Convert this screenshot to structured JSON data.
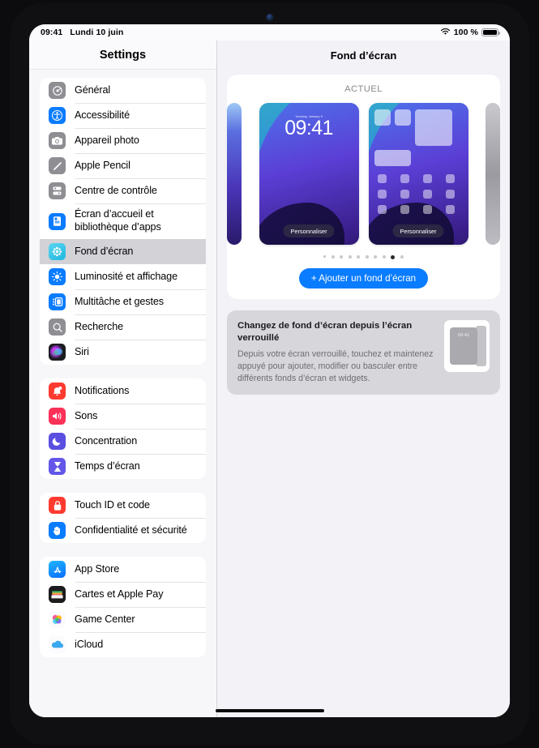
{
  "status_bar": {
    "time": "09:41",
    "date": "Lundi 10 juin",
    "wifi_icon": "wifi-icon",
    "battery_percent": "100 %",
    "battery_icon": "battery-full-icon"
  },
  "sidebar": {
    "title": "Settings",
    "groups": [
      {
        "items": [
          {
            "label": "Général",
            "icon": "gear-icon",
            "selected": false
          },
          {
            "label": "Accessibilité",
            "icon": "accessibility-icon",
            "selected": false
          },
          {
            "label": "Appareil photo",
            "icon": "camera-icon",
            "selected": false
          },
          {
            "label": "Apple Pencil",
            "icon": "pencil-icon",
            "selected": false
          },
          {
            "label": "Centre de contrôle",
            "icon": "control-center-icon",
            "selected": false
          },
          {
            "label": "Écran d’accueil et bibliothèque d’apps",
            "icon": "home-screen-icon",
            "selected": false
          },
          {
            "label": "Fond d’écran",
            "icon": "wallpaper-icon",
            "selected": true
          },
          {
            "label": "Luminosité et affichage",
            "icon": "brightness-icon",
            "selected": false
          },
          {
            "label": "Multitâche et gestes",
            "icon": "multitasking-icon",
            "selected": false
          },
          {
            "label": "Recherche",
            "icon": "search-icon",
            "selected": false
          },
          {
            "label": "Siri",
            "icon": "siri-icon",
            "selected": false
          }
        ]
      },
      {
        "items": [
          {
            "label": "Notifications",
            "icon": "notifications-icon",
            "selected": false
          },
          {
            "label": "Sons",
            "icon": "sound-icon",
            "selected": false
          },
          {
            "label": "Concentration",
            "icon": "focus-moon-icon",
            "selected": false
          },
          {
            "label": "Temps d’écran",
            "icon": "screen-time-icon",
            "selected": false
          }
        ]
      },
      {
        "items": [
          {
            "label": "Touch ID et code",
            "icon": "touch-id-lock-icon",
            "selected": false
          },
          {
            "label": "Confidentialité et sécurité",
            "icon": "privacy-hand-icon",
            "selected": false
          }
        ]
      },
      {
        "items": [
          {
            "label": "App Store",
            "icon": "app-store-icon",
            "selected": false
          },
          {
            "label": "Cartes et Apple Pay",
            "icon": "wallet-icon",
            "selected": false
          },
          {
            "label": "Game Center",
            "icon": "game-center-icon",
            "selected": false
          },
          {
            "label": "iCloud",
            "icon": "icloud-icon",
            "selected": false
          }
        ]
      }
    ]
  },
  "detail": {
    "title": "Fond d’écran",
    "current_section": {
      "heading": "ACTUEL",
      "lock_screen": {
        "date": "Tuesday, January 9",
        "clock": "09:41",
        "customize_label": "Personnaliser"
      },
      "home_screen": {
        "customize_label": "Personnaliser"
      },
      "page_dots": {
        "count": 10,
        "active_index": 8
      },
      "add_button_label": "+ Ajouter un fond d’écran"
    },
    "info_card": {
      "heading": "Changez de fond d’écran depuis l’écran verrouillé",
      "body": "Depuis votre écran verrouillé, touchez et maintenez appuyé pour ajouter, modifier ou basculer entre différents fonds d’écran et widgets.",
      "preview_clock": "09:41"
    }
  },
  "colors": {
    "accent_blue": "#0a7cff",
    "selected_row": "#d2d2d7",
    "page_background": "#f2f2f7",
    "info_card": "#d6d6db"
  }
}
